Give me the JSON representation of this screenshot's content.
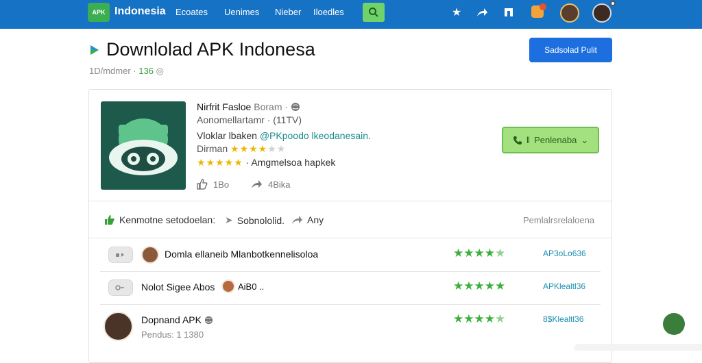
{
  "nav": {
    "logo_text": "APK",
    "brand": "Indonesia",
    "links": [
      "Ecoates",
      "Uenimes",
      "Nieber",
      "Iloedles"
    ]
  },
  "header": {
    "title": "Downlolad APK Indonesa",
    "meta_prefix": "1D/mdmer ·",
    "meta_num": "136",
    "meta_suffix": "◎",
    "primary_button": "Sadsolad Pulit"
  },
  "app": {
    "name": "Nirfrit Fasloe",
    "name_sub": "Boram ·",
    "line1": "Aonomellartamr · (11TV)",
    "line2_prefix": "Vloklar lbaken",
    "line2_link": "@PKpoodo lkeodanesain.",
    "line3_label": "Dirman",
    "line3_stars": "★★★★",
    "line3_dim": "★★",
    "line4_stars": "★★★★★",
    "line4_text": "· Amgmelsoa hapkek",
    "likes": "1Bo",
    "shares": "4Bika",
    "install_button": "Penlenaba"
  },
  "filter": {
    "label": "Kenmotne setodoelan:",
    "option1": "Sobnololid.",
    "option2": "Any",
    "right": "Pemlalrsrelaloena"
  },
  "rows": [
    {
      "title": "Domla ellaneib Mlanbotkennelisoloa",
      "stars": "★★★★",
      "stars_dim": "★",
      "link": "AP3oLo636"
    },
    {
      "title": "Nolot Sigee Abos",
      "title_extra": "AiB0 ..",
      "stars": "★★★★★",
      "stars_dim": "",
      "link": "APKlealtl36"
    },
    {
      "title": "Dopnand APK",
      "sub": "Pendus: 1 1380",
      "stars": "★★★★",
      "stars_dim": "★",
      "link": "8$Klealtl36"
    }
  ],
  "colors": {
    "topbar": "#1672c4",
    "primary": "#1d6fe0",
    "install": "#a3e07e",
    "stars_yellow": "#f0b400",
    "stars_green": "#3ab03a"
  },
  "icons": [
    "star-icon",
    "share-icon",
    "bookmark-icon",
    "chat-icon",
    "search-icon",
    "globe-icon",
    "like-icon",
    "download-icon",
    "phone-icon",
    "chevron-down-icon"
  ]
}
